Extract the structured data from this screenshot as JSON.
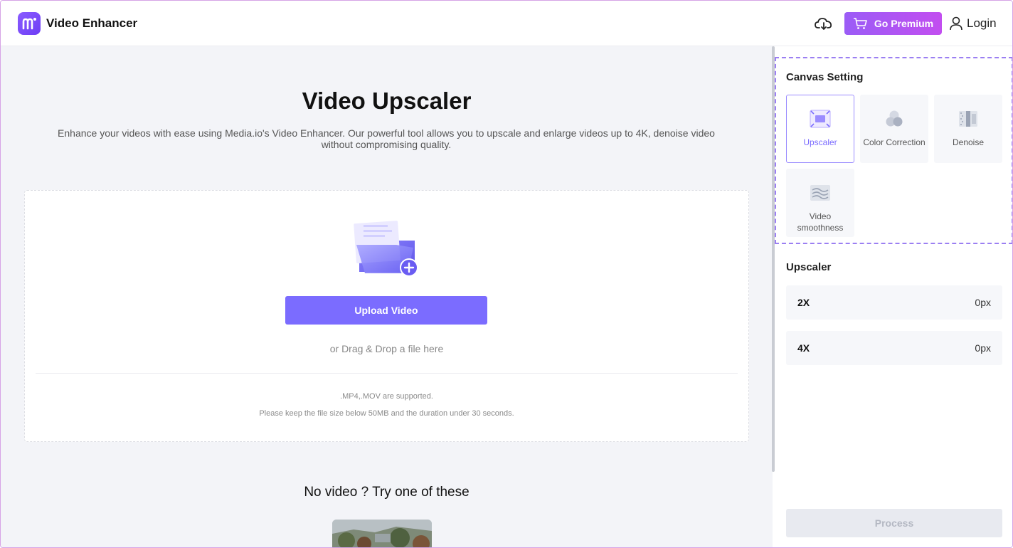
{
  "header": {
    "app_title": "Video Enhancer",
    "premium_label": "Go Premium",
    "login_label": "Login"
  },
  "main": {
    "title": "Video Upscaler",
    "description": "Enhance your videos with ease using Media.io's Video Enhancer. Our powerful tool allows you to upscale and enlarge videos up to 4K, denoise video without compromising quality.",
    "upload_button": "Upload Video",
    "drag_text": "or Drag & Drop a file here",
    "support_text": ".MP4,.MOV are supported.",
    "limit_text": "Please keep the file size below 50MB and the duration under 30 seconds.",
    "sample_title": "No video ? Try one of these"
  },
  "panel": {
    "canvas_title": "Canvas Setting",
    "tools": [
      {
        "label": "Upscaler",
        "icon": "upscaler-icon",
        "active": true
      },
      {
        "label": "Color Correction",
        "icon": "color-correction-icon",
        "active": false
      },
      {
        "label": "Denoise",
        "icon": "denoise-icon",
        "active": false
      },
      {
        "label": "Video smoothness",
        "icon": "video-smoothness-icon",
        "active": false
      }
    ],
    "upscaler_title": "Upscaler",
    "scales": [
      {
        "label": "2X",
        "value": "0px"
      },
      {
        "label": "4X",
        "value": "0px"
      }
    ],
    "process_button": "Process"
  },
  "colors": {
    "accent": "#7b6cff",
    "premium_start": "#9b5cf6",
    "premium_end": "#c24ef0"
  }
}
